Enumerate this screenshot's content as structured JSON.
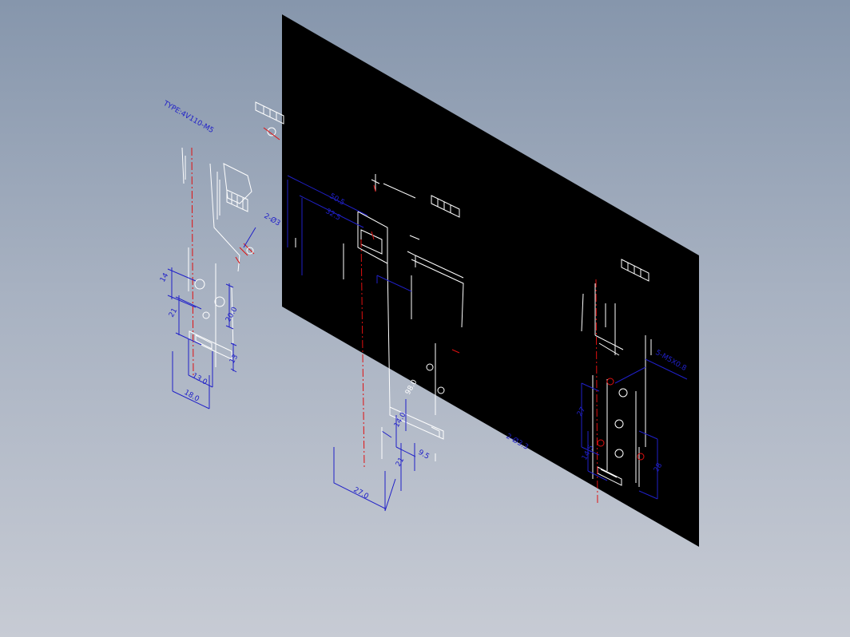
{
  "viewer": {
    "background_top": "#8696ac",
    "background_bottom": "#c7cbd4",
    "sheet_color": "#000000"
  },
  "colors": {
    "geometry": "#ffffff",
    "dimension": "#2020c8",
    "centerline": "#e01010"
  },
  "labels": {
    "type_label": "TYPE:4V110-M5",
    "d_27_0": "27.0",
    "d_18_0": "18.0",
    "d_13_0": "13.0",
    "d_14": "14",
    "d_21_left": "21",
    "d_20_0": "20.0",
    "d_13": "13",
    "d_50_5": "50.5",
    "d_32_5": "32.5",
    "d_2_phi": "2-Ø3",
    "d_98_0": "98.0",
    "d_14_0": "14.0",
    "d_21_mid": "21",
    "d_9_5": "9.5",
    "d_2_phi_3_3": "2-Ø3.3",
    "d_5_m5": "5-M5X0.8",
    "d_27_right": "27",
    "d_14_5": "14.5",
    "d_28": "28"
  }
}
